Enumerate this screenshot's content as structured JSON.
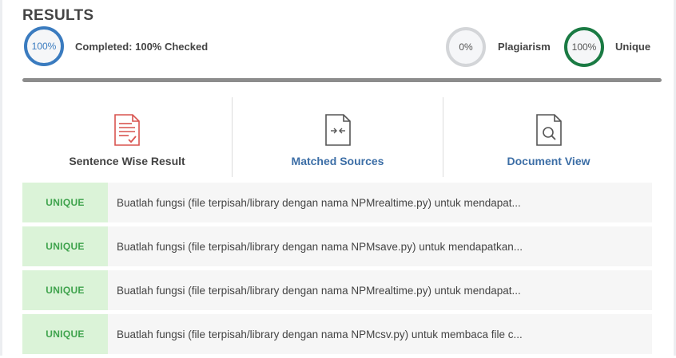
{
  "header": {
    "title": "RESULTS"
  },
  "stats": {
    "completed_percent": "100%",
    "completed_label": "Completed: 100% Checked",
    "plagiarism_percent": "0%",
    "plagiarism_label": "Plagiarism",
    "unique_percent": "100%",
    "unique_label": "Unique"
  },
  "progress": {
    "value": 1.0
  },
  "tabs": [
    {
      "label": "Sentence Wise Result",
      "icon": "sentence-wise-icon",
      "active": true
    },
    {
      "label": "Matched Sources",
      "icon": "matched-sources-icon",
      "active": false
    },
    {
      "label": "Document View",
      "icon": "document-view-icon",
      "active": false
    }
  ],
  "results": [
    {
      "status": "UNIQUE",
      "text": "Buatlah fungsi (file terpisah/library dengan nama NPMrealtime.py) untuk mendapat..."
    },
    {
      "status": "UNIQUE",
      "text": "Buatlah fungsi (file terpisah/library dengan nama NPMsave.py) untuk mendapatkan..."
    },
    {
      "status": "UNIQUE",
      "text": "Buatlah fungsi (file terpisah/library dengan nama NPMrealtime.py) untuk mendapat..."
    },
    {
      "status": "UNIQUE",
      "text": "Buatlah fungsi (file terpisah/library dengan nama NPMcsv.py) untuk membaca file c..."
    }
  ],
  "colors": {
    "accent_blue": "#3a7bbf",
    "unique_green": "#1a7a43",
    "badge_bg": "#dbf3d8",
    "badge_text": "#3fa34d",
    "link_blue": "#3c6ea6",
    "error_red": "#d9534f"
  }
}
